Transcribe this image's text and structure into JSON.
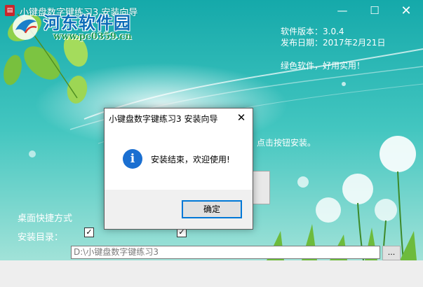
{
  "window": {
    "title": "小键盘数字键练习3 安装向导",
    "icon_glyph": "▤",
    "minimize_glyph": "—",
    "maximize_glyph": "☐",
    "close_glyph": "✕"
  },
  "watermark": {
    "logo_text": "河东软件园",
    "url": "www.pc0359.cn"
  },
  "info": {
    "version": "软件版本：3.0.4",
    "release_date": "发布日期：2017年2月21日",
    "tagline": "绿色软件，好用实用！"
  },
  "install": {
    "hint_text": "点击按钮安装。",
    "shortcut_label": "桌面快捷方式",
    "dir_label": "安装目录：",
    "checkbox_glyph": "✓",
    "path_value": "D:\\小键盘数字键练习3",
    "browse_label": "..."
  },
  "dialog": {
    "title": "小键盘数字键练习3 安装向导",
    "close_glyph": "✕",
    "info_icon_glyph": "i",
    "message": "安装结束，欢迎使用!",
    "ok_label": "确定"
  },
  "colors": {
    "sky_top": "#1ab0b0",
    "sky_bottom": "#9fe0d8",
    "dialog_icon": "#1a6fd1",
    "leaf_green": "#7cc441"
  }
}
